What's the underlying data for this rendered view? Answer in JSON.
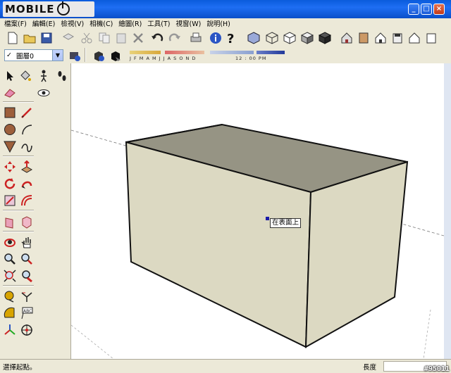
{
  "title_bar": {
    "logo_text": "MOBILE"
  },
  "window_buttons": {
    "minimize": "_",
    "maximize": "□",
    "close": "×"
  },
  "menu": [
    "檔案(F)",
    "編輯(E)",
    "檢視(V)",
    "相機(C)",
    "繪圖(R)",
    "工具(T)",
    "視窗(W)",
    "說明(H)"
  ],
  "layer": {
    "check": "✓",
    "value": "圖層0",
    "arrow": "▼"
  },
  "shadow": {
    "months": "J F M A M J J A S O N D",
    "time": "12 : 00 PM"
  },
  "canvas": {
    "inference_tooltip": "在表面上"
  },
  "status": {
    "hint": "選擇起點。",
    "measure_label": "長度",
    "watermark": "#95011"
  },
  "colors": {
    "box_side": "#dcd9c2",
    "box_top": "#969484",
    "titlebar": "#1e6ef3"
  }
}
